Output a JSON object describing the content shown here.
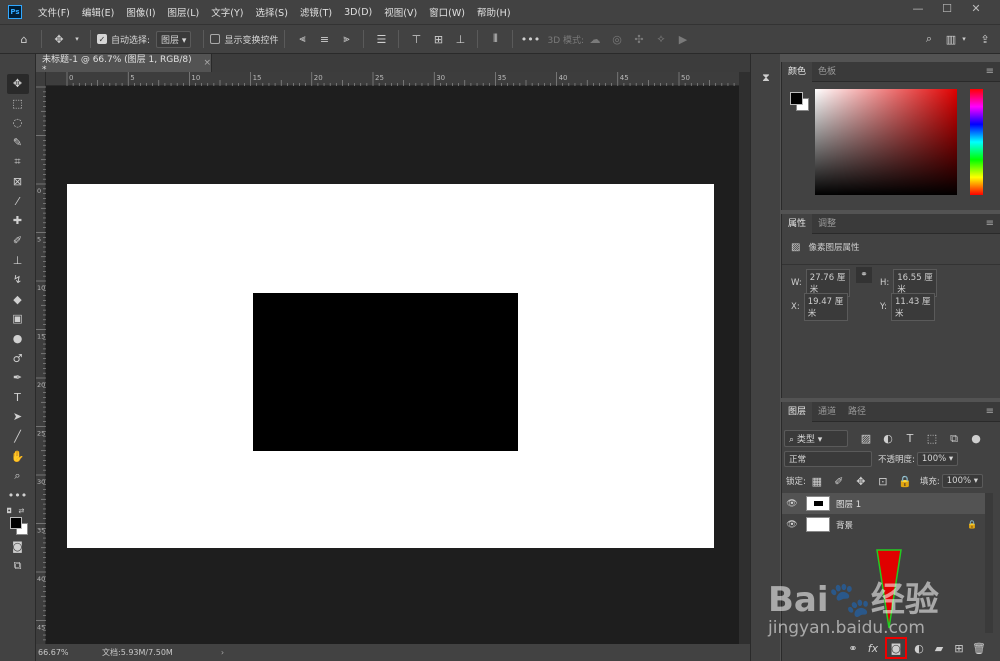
{
  "app": {
    "logo": "Ps"
  },
  "menu": [
    "文件(F)",
    "编辑(E)",
    "图像(I)",
    "图层(L)",
    "文字(Y)",
    "选择(S)",
    "滤镜(T)",
    "3D(D)",
    "视图(V)",
    "窗口(W)",
    "帮助(H)"
  ],
  "window_controls": {
    "minimize": "—",
    "maximize": "☐",
    "close": "✕"
  },
  "options": {
    "auto_select_label": "自动选择:",
    "auto_select_checked": true,
    "auto_select_target": "图层",
    "show_transform_label": "显示变换控件",
    "show_transform_checked": false,
    "more": "•••",
    "mode_3d_label": "3D 模式:"
  },
  "document": {
    "tab_title": "未标题-1 @ 66.7% (图层 1, RGB/8) *",
    "tab_close": "×",
    "zoom": "66.67%",
    "doc_info": "文档:5.93M/7.50M",
    "ruler_h": [
      "0",
      "5",
      "10",
      "15",
      "20",
      "25",
      "30",
      "35",
      "40",
      "45",
      "50"
    ],
    "ruler_v": [
      "0",
      "5",
      "10",
      "15",
      "20",
      "25",
      "30",
      "35",
      "40",
      "45"
    ],
    "canvas_color": "#ffffff",
    "shape_color": "#000000"
  },
  "tools": [
    {
      "name": "move-tool-icon",
      "glyph": "✥"
    },
    {
      "name": "marquee-tool-icon",
      "glyph": "⬚"
    },
    {
      "name": "lasso-tool-icon",
      "glyph": "◌"
    },
    {
      "name": "quick-select-tool-icon",
      "glyph": "✎"
    },
    {
      "name": "crop-tool-icon",
      "glyph": "⌗"
    },
    {
      "name": "frame-tool-icon",
      "glyph": "⊠"
    },
    {
      "name": "eyedropper-tool-icon",
      "glyph": "⁄"
    },
    {
      "name": "healing-brush-tool-icon",
      "glyph": "✚"
    },
    {
      "name": "brush-tool-icon",
      "glyph": "✐"
    },
    {
      "name": "clone-stamp-tool-icon",
      "glyph": "⊥"
    },
    {
      "name": "history-brush-tool-icon",
      "glyph": "↯"
    },
    {
      "name": "eraser-tool-icon",
      "glyph": "◆"
    },
    {
      "name": "gradient-tool-icon",
      "glyph": "▣"
    },
    {
      "name": "blur-tool-icon",
      "glyph": "●"
    },
    {
      "name": "dodge-tool-icon",
      "glyph": "♂"
    },
    {
      "name": "pen-tool-icon",
      "glyph": "✒"
    },
    {
      "name": "type-tool-icon",
      "glyph": "T"
    },
    {
      "name": "path-select-tool-icon",
      "glyph": "➤"
    },
    {
      "name": "line-tool-icon",
      "glyph": "╱"
    },
    {
      "name": "hand-tool-icon",
      "glyph": "✋"
    },
    {
      "name": "zoom-tool-icon",
      "glyph": "⌕"
    },
    {
      "name": "more-tools-icon",
      "glyph": "•••"
    }
  ],
  "color_panel": {
    "tabs": [
      "颜色",
      "色板"
    ],
    "foreground": "#000000",
    "background": "#ffffff"
  },
  "properties_panel": {
    "tabs": [
      "属性",
      "调整"
    ],
    "section_title": "像素图层属性",
    "w_label": "W:",
    "w_value": "27.76 厘米",
    "h_label": "H:",
    "h_value": "16.55 厘米",
    "x_label": "X:",
    "x_value": "19.47 厘米",
    "y_label": "Y:",
    "y_value": "11.43 厘米"
  },
  "layers_panel": {
    "tabs": [
      "图层",
      "通道",
      "路径"
    ],
    "filter_kind": "类型",
    "blend_mode": "正常",
    "opacity_label": "不透明度:",
    "opacity_value": "100%",
    "lock_label": "锁定:",
    "fill_label": "填充:",
    "fill_value": "100%",
    "layers": [
      {
        "name": "图层 1",
        "selected": true,
        "visible": true,
        "locked": false
      },
      {
        "name": "背景",
        "selected": false,
        "visible": true,
        "locked": true
      }
    ],
    "footer_fx": "fx"
  },
  "watermark": {
    "logo": "Bai🐾经验",
    "url": "jingyan.baidu.com"
  },
  "accent": "#31a8ff",
  "highlight_color": "#e00000"
}
